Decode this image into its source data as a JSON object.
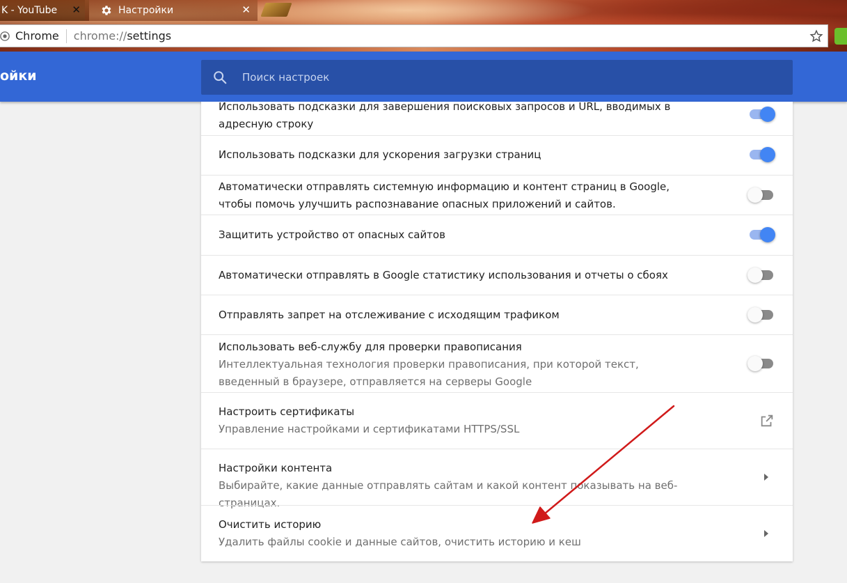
{
  "browser": {
    "tabs": [
      {
        "title": "K - YouTube",
        "close": "✕"
      },
      {
        "title": "Настройки",
        "close": "✕"
      }
    ],
    "omnibox": {
      "origin": "Chrome",
      "scheme": "chrome://",
      "path": "settings"
    }
  },
  "header": {
    "title": "ойки",
    "search_placeholder": "Поиск настроек"
  },
  "settings": [
    {
      "label": "Использовать подсказки для завершения поисковых запросов и URL, вводимых в адресную строку",
      "toggle": "on"
    },
    {
      "label": "Использовать подсказки для ускорения загрузки страниц",
      "toggle": "on"
    },
    {
      "label": "Автоматически отправлять системную информацию и контент страниц в Google, чтобы помочь улучшить распознавание опасных приложений и сайтов.",
      "toggle": "off"
    },
    {
      "label": "Защитить устройство от опасных сайтов",
      "toggle": "on"
    },
    {
      "label": "Автоматически отправлять в Google статистику использования и отчеты о сбоях",
      "toggle": "off"
    },
    {
      "label": "Отправлять запрет на отслеживание с исходящим трафиком",
      "toggle": "off"
    },
    {
      "label": "Использовать веб-службу для проверки правописания",
      "sublabel": "Интеллектуальная технология проверки правописания, при которой текст, введенный в браузере, отправляется на серверы Google",
      "toggle": "off"
    },
    {
      "label": "Настроить сертификаты",
      "sublabel": "Управление настройками и сертификатами HTTPS/SSL",
      "action": "external-link-icon"
    },
    {
      "label": "Настройки контента",
      "sublabel": "Выбирайте, какие данные отправлять сайтам и какой контент показывать на веб-страницах.",
      "action": "arrow-right-icon"
    },
    {
      "label": "Очистить историю",
      "sublabel": "Удалить файлы cookie и данные сайтов, очистить историю и кеш",
      "action": "arrow-right-icon"
    }
  ],
  "colors": {
    "header_blue": "#3367d6",
    "search_bg": "#2850a7",
    "toggle_on": "#4285f4",
    "annotation_arrow": "#d01a1a"
  }
}
